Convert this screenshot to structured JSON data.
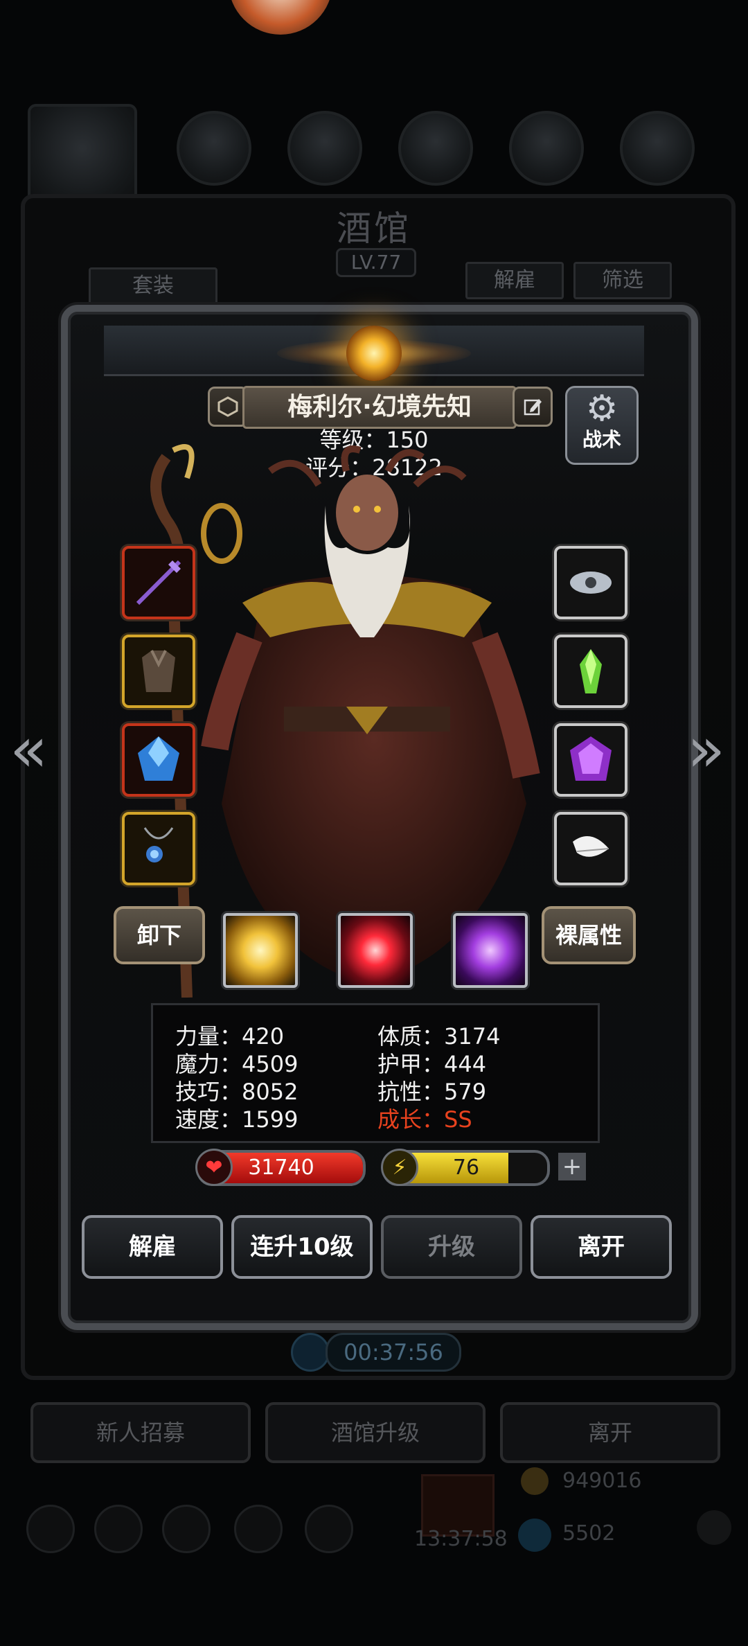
{
  "background": {
    "title": "酒馆",
    "level": "LV.77",
    "left_button": "套装",
    "right_buttons": [
      "解雇",
      "筛选"
    ],
    "timer": "00:37:56",
    "bottom_buttons": [
      "新人招募",
      "酒馆升级",
      "离开"
    ],
    "gold": "949016",
    "gems": "5502",
    "clock": "13:37:58"
  },
  "hero": {
    "name": "梅利尔·幻境先知",
    "level_text": "等级：150",
    "score_text": "评分：28122",
    "tactic_label": "战术"
  },
  "equipment": {
    "left": [
      "staff-weapon",
      "armor",
      "blue-crystal",
      "amulet"
    ],
    "right": [
      "cloud-ring",
      "green-crystal",
      "purple-gem",
      "white-feather"
    ]
  },
  "actions": {
    "unequip": "卸下",
    "base_attrs": "裸属性"
  },
  "skills": [
    "golden-burst",
    "red-slash",
    "purple-claw"
  ],
  "stats": {
    "left": [
      "力量：420",
      "魔力：4509",
      "技巧：8052",
      "速度：1599"
    ],
    "right": [
      "体质：3174",
      "护甲：444",
      "抗性：579"
    ],
    "growth": "成长：SS"
  },
  "bars": {
    "hp": "31740",
    "energy": "76",
    "energy_fill": 0.76
  },
  "buttons": {
    "dismiss": "解雇",
    "level_up_10": "连升10级",
    "level_up": "升级",
    "leave": "离开"
  },
  "colors": {
    "hp": "#d11a1a",
    "energy": "#e6c21d",
    "growth": "#e8421e"
  }
}
